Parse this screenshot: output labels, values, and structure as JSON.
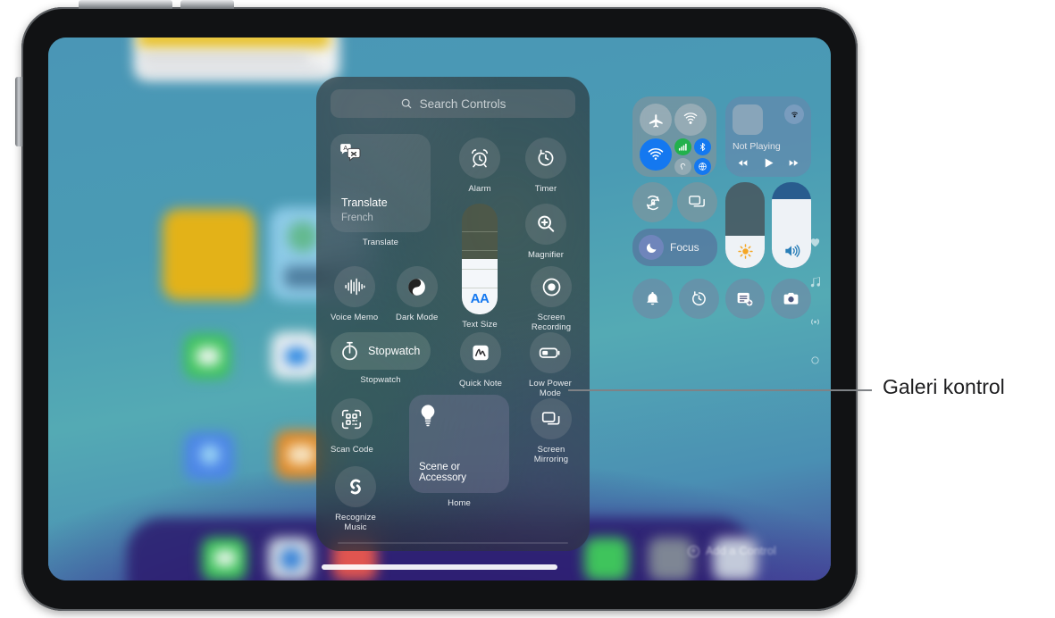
{
  "device": {
    "name": "ipad-frame"
  },
  "callout": {
    "label": "Galeri kontrol"
  },
  "wallpaper": {
    "add_a_control": "Add a Control"
  },
  "gallery": {
    "search": {
      "placeholder": "Search Controls",
      "icon": "search-icon"
    },
    "items": [
      {
        "id": "translate",
        "type": "tile",
        "label": "Translate",
        "title": "Translate",
        "subtitle": "French",
        "icon": "translate-icon"
      },
      {
        "id": "alarm",
        "type": "circle",
        "label": "Alarm",
        "icon": "alarm-clock-icon"
      },
      {
        "id": "timer",
        "type": "circle",
        "label": "Timer",
        "icon": "timer-icon"
      },
      {
        "id": "text-size",
        "type": "slider",
        "label": "Text Size",
        "icon": "aa-icon",
        "value_text": "AA",
        "fill_percent": 50
      },
      {
        "id": "magnifier",
        "type": "circle",
        "label": "Magnifier",
        "icon": "magnifier-icon"
      },
      {
        "id": "voice-memo",
        "type": "circle",
        "label": "Voice Memo",
        "icon": "waveform-icon"
      },
      {
        "id": "dark-mode",
        "type": "circle",
        "label": "Dark Mode",
        "icon": "dark-mode-icon"
      },
      {
        "id": "screen-recording",
        "type": "circle",
        "label": "Screen Recording",
        "icon": "record-icon"
      },
      {
        "id": "stopwatch",
        "type": "pill",
        "label": "Stopwatch",
        "title": "Stopwatch",
        "icon": "stopwatch-icon"
      },
      {
        "id": "quick-note",
        "type": "circle",
        "label": "Quick Note",
        "icon": "quick-note-icon"
      },
      {
        "id": "low-power-mode",
        "type": "circle",
        "label": "Low Power Mode",
        "icon": "battery-icon"
      },
      {
        "id": "scan-code",
        "type": "circle",
        "label": "Scan Code",
        "icon": "qr-code-icon"
      },
      {
        "id": "screen-mirroring",
        "type": "circle",
        "label": "Screen Mirroring",
        "icon": "screen-mirroring-icon"
      },
      {
        "id": "home-scene",
        "type": "tile",
        "label": "Home",
        "title": "Scene or Accessory",
        "icon": "lightbulb-icon"
      },
      {
        "id": "recognize-music",
        "type": "circle",
        "label": "Recognize Music",
        "icon": "shazam-icon"
      }
    ]
  },
  "control_center": {
    "connectivity": {
      "airplane_mode": {
        "label": "Airplane Mode",
        "icon": "airplane-icon",
        "on": false
      },
      "airdrop": {
        "label": "AirDrop",
        "icon": "airdrop-icon",
        "on": false
      },
      "wifi": {
        "label": "Wi-Fi",
        "icon": "wifi-icon",
        "on": true
      },
      "cellular": {
        "label": "Cellular Data",
        "icon": "cellular-bars-icon",
        "on": true
      },
      "bluetooth": {
        "label": "Bluetooth",
        "icon": "bluetooth-icon",
        "on": true
      },
      "hotspot": {
        "label": "Personal Hotspot",
        "icon": "hotspot-icon",
        "on": false
      },
      "vpn": {
        "label": "VPN",
        "icon": "vpn-globe-icon",
        "on": true
      }
    },
    "now_playing": {
      "status": "Not Playing",
      "airplay_icon": "airplay-audio-icon",
      "previous_icon": "rewind-icon",
      "play_icon": "play-icon",
      "next_icon": "fast-forward-icon"
    },
    "rotation_lock": {
      "label": "Rotation Lock",
      "icon": "rotation-lock-icon"
    },
    "screen_mirroring": {
      "label": "Screen Mirroring",
      "icon": "screen-mirroring-icon"
    },
    "focus": {
      "label": "Focus",
      "icon": "moon-icon"
    },
    "brightness": {
      "label": "Brightness",
      "icon": "sun-icon",
      "fill_percent": 38
    },
    "volume": {
      "label": "Volume",
      "icon": "speaker-wave-icon",
      "fill_percent": 80
    },
    "bottom_row": [
      {
        "id": "silent-mode",
        "label": "Ring/Silent",
        "icon": "bell-icon"
      },
      {
        "id": "timer",
        "label": "Timer",
        "icon": "timer-icon"
      },
      {
        "id": "quick-note",
        "label": "Quick Note",
        "icon": "quick-note-plus-icon"
      },
      {
        "id": "camera",
        "label": "Camera",
        "icon": "camera-icon"
      }
    ]
  },
  "edge_icons": [
    {
      "id": "health",
      "icon": "heart-icon"
    },
    {
      "id": "music",
      "icon": "music-note-icon"
    },
    {
      "id": "broadcast",
      "icon": "broadcast-icon"
    },
    {
      "id": "page-dot",
      "icon": "circle-dot-icon"
    }
  ],
  "colors": {
    "accent_blue": "#1478f0",
    "green": "#22b14c",
    "brightness_fill": "#eef2f6",
    "text_size_blue": "#1478f0"
  }
}
